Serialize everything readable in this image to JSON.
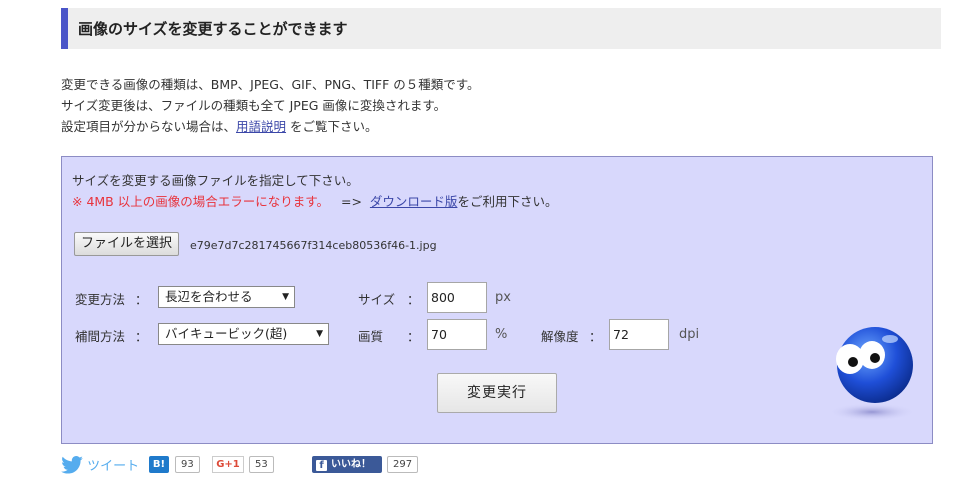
{
  "heading": "画像のサイズを変更することができます",
  "intro": {
    "line1": "変更できる画像の種類は、BMP、JPEG、GIF、PNG、TIFF の５種類です。",
    "line2": "サイズ変更後は、ファイルの種類も全て JPEG 画像に変換されます。",
    "line3_before": "設定項目が分からない場合は、",
    "line3_link": "用語説明",
    "line3_after": " をご覧下さい。"
  },
  "panel": {
    "instruction": "サイズを変更する画像ファイルを指定して下さい。",
    "warning": "※ 4MB 以上の画像の場合エラーになります。",
    "arrow": "=>",
    "download_link": "ダウンロード版",
    "download_suffix": "をご利用下さい。",
    "file_button": "ファイルを選択",
    "file_name": "e79e7d7c281745667f314ceb80536f46-1.jpg",
    "method_label": "変更方法",
    "method_value": "長辺を合わせる",
    "interp_label": "補間方法",
    "interp_value": "バイキュービック(超)",
    "size_label": "サイズ",
    "size_value": "800",
    "size_unit": "px",
    "quality_label": "画質",
    "quality_value": "70",
    "quality_unit": "%",
    "resolution_label": "解像度",
    "resolution_value": "72",
    "resolution_unit": "dpi",
    "colon": "：",
    "execute_button": "変更実行"
  },
  "social": {
    "tweet": "ツイート",
    "hatena_icon": "B!",
    "hatena_count": "93",
    "gplus_icon": "G+1",
    "gplus_count": "53",
    "fb_icon": "f",
    "fb_label": "いいね！",
    "fb_count": "297"
  },
  "colors": {
    "accent": "#4a55c8",
    "panel_bg": "#d8d8fc",
    "warning": "#e8333c",
    "link": "#3b47a8"
  }
}
